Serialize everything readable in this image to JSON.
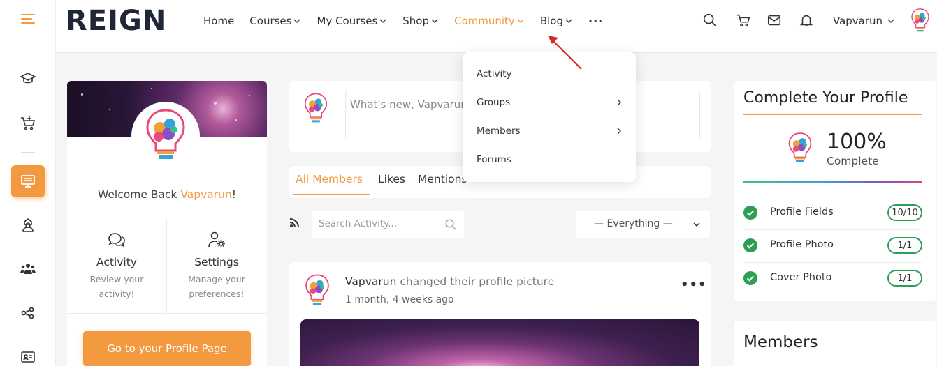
{
  "brand": {
    "logo_text": "REIGN",
    "accent": "#f39a40",
    "dark": "#1f2637"
  },
  "rail": {
    "items": [
      {
        "icon": "hamburger-icon"
      },
      {
        "icon": "graduation-cap-icon"
      },
      {
        "icon": "cart-add-icon"
      },
      {
        "icon": "monitor-icon",
        "active": true
      },
      {
        "icon": "user-hood-icon"
      },
      {
        "icon": "users-group-icon"
      },
      {
        "icon": "share-nodes-icon"
      },
      {
        "icon": "id-card-icon"
      }
    ]
  },
  "nav": {
    "items": [
      {
        "label": "Home",
        "has_dropdown": false
      },
      {
        "label": "Courses",
        "has_dropdown": true
      },
      {
        "label": "My Courses",
        "has_dropdown": true
      },
      {
        "label": "Shop",
        "has_dropdown": true
      },
      {
        "label": "Community",
        "has_dropdown": true,
        "active": true
      },
      {
        "label": "Blog",
        "has_dropdown": true
      }
    ],
    "more": "···"
  },
  "header_icons": [
    "search-icon",
    "cart-icon",
    "mail-icon",
    "bell-icon"
  ],
  "user": {
    "name": "Vapvarun"
  },
  "community_menu": {
    "items": [
      {
        "label": "Activity",
        "submenu": false
      },
      {
        "label": "Groups",
        "submenu": true
      },
      {
        "label": "Members",
        "submenu": true
      },
      {
        "label": "Forums",
        "submenu": false
      }
    ]
  },
  "profile_card": {
    "welcome_prefix": "Welcome Back ",
    "welcome_name": "Vapvarun",
    "welcome_suffix": "!",
    "activity": {
      "title": "Activity",
      "subtitle": "Review your activity!"
    },
    "settings": {
      "title": "Settings",
      "subtitle": "Manage your preferences!"
    },
    "button": "Go to your Profile Page"
  },
  "post_box": {
    "placeholder": "What's new, Vapvarun?"
  },
  "tabs": [
    "All Members",
    "Likes",
    "Mentions"
  ],
  "filters": {
    "search_placeholder": "Search Activity...",
    "select_value": "— Everything —"
  },
  "activity_item": {
    "author": "Vapvarun",
    "action": " changed their profile picture",
    "time": "1 month, 4 weeks ago",
    "more": "•••"
  },
  "complete_profile": {
    "title": "Complete Your Profile",
    "percent": "100%",
    "percent_value": 100,
    "label": "Complete",
    "rows": [
      {
        "label": "Profile Fields",
        "value": "10/10"
      },
      {
        "label": "Profile Photo",
        "value": "1/1"
      },
      {
        "label": "Cover Photo",
        "value": "1/1"
      }
    ]
  },
  "members_widget": {
    "title": "Members"
  }
}
